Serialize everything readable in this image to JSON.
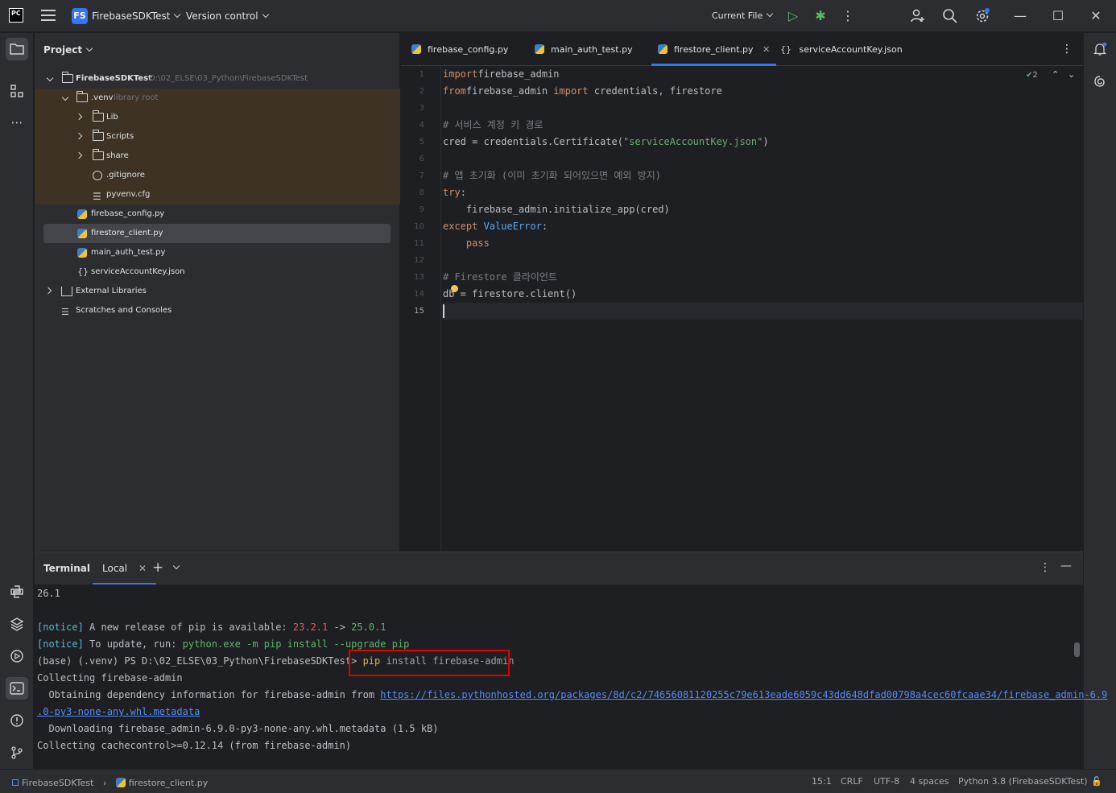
{
  "titlebar": {
    "app_logo": "PC",
    "project_badge": "FS",
    "project_name": "FirebaseSDKTest",
    "version_control": "Version control",
    "run_config": "Current File",
    "icons": [
      "menu-icon",
      "run-icon",
      "debug-icon",
      "more-icon",
      "add-user-icon",
      "search-icon",
      "settings-icon",
      "minimize-icon",
      "maximize-icon",
      "close-icon"
    ]
  },
  "project_panel": {
    "header": "Project",
    "root_name": "FirebaseSDKTest",
    "root_path": "D:\\02_ELSE\\03_Python\\FirebaseSDKTest",
    "venv_name": ".venv",
    "venv_note": "library root",
    "items": [
      {
        "label": "Lib"
      },
      {
        "label": "Scripts"
      },
      {
        "label": "share"
      },
      {
        "label": ".gitignore"
      },
      {
        "label": "pyvenv.cfg"
      },
      {
        "label": "firebase_config.py"
      },
      {
        "label": "firestore_client.py"
      },
      {
        "label": "main_auth_test.py"
      },
      {
        "label": "serviceAccountKey.json"
      },
      {
        "label": "External Libraries"
      },
      {
        "label": "Scratches and Consoles"
      }
    ]
  },
  "editor": {
    "tabs": [
      {
        "label": "firebase_config.py"
      },
      {
        "label": "main_auth_test.py"
      },
      {
        "label": "firestore_client.py"
      },
      {
        "label": "serviceAccountKey.json"
      }
    ],
    "inspection_count": "2",
    "lines": [
      {
        "n": "1",
        "parts": [
          [
            "kw",
            "import"
          ],
          [
            "",
            "firebase_admin"
          ]
        ]
      },
      {
        "n": "2",
        "parts": [
          [
            "kw",
            "from"
          ],
          [
            "",
            "firebase_admin "
          ],
          [
            "kw",
            "import"
          ],
          [
            "",
            " credentials, firestore"
          ]
        ]
      },
      {
        "n": "3",
        "parts": []
      },
      {
        "n": "4",
        "parts": [
          [
            "cmt",
            "# 서비스 계정 키 경로"
          ]
        ]
      },
      {
        "n": "5",
        "parts": [
          [
            "",
            "cred = credentials.Certificate("
          ],
          [
            "str",
            "\"serviceAccountKey.json\""
          ],
          [
            "",
            ")"
          ]
        ]
      },
      {
        "n": "6",
        "parts": []
      },
      {
        "n": "7",
        "parts": [
          [
            "cmt",
            "# 앱 초기화 (이미 초기화 되어있으면 예외 방지)"
          ]
        ]
      },
      {
        "n": "8",
        "parts": [
          [
            "kw",
            "try"
          ],
          [
            "",
            ":"
          ]
        ]
      },
      {
        "n": "9",
        "parts": [
          [
            "",
            "    firebase_admin.initialize_app(cred)"
          ]
        ]
      },
      {
        "n": "10",
        "parts": [
          [
            "kw",
            "except"
          ],
          [
            "",
            " "
          ],
          [
            "cls",
            "ValueError"
          ],
          [
            "",
            ":"
          ]
        ]
      },
      {
        "n": "11",
        "parts": [
          [
            "",
            "    "
          ],
          [
            "kw",
            "pass"
          ]
        ]
      },
      {
        "n": "12",
        "parts": []
      },
      {
        "n": "13",
        "parts": [
          [
            "cmt",
            "# Firestore 클라이언트"
          ]
        ]
      },
      {
        "n": "14",
        "parts": [
          [
            "",
            "db = firestore.client()"
          ]
        ]
      },
      {
        "n": "15",
        "parts": []
      }
    ]
  },
  "terminal": {
    "title": "Terminal",
    "tab": "Local",
    "lines": [
      [
        [
          "",
          "26.1"
        ]
      ],
      [],
      [
        [
          "t-cyan",
          "[notice]"
        ],
        [
          "",
          " A new release of pip is available: "
        ],
        [
          "t-red",
          "23.2.1"
        ],
        [
          "",
          " -> "
        ],
        [
          "t-green",
          "25.0.1"
        ]
      ],
      [
        [
          "t-cyan",
          "[notice]"
        ],
        [
          "",
          " To update, run: "
        ],
        [
          "t-green",
          "python.exe -m pip install --upgrade pip"
        ]
      ],
      [
        [
          "",
          "(base) (.venv) PS D:\\02_ELSE\\03_Python\\FirebaseSDKTest> "
        ],
        [
          "t-yellow",
          "pip"
        ],
        [
          "t-gray",
          " install firebase-admin"
        ]
      ],
      [
        [
          "",
          "Collecting firebase-admin"
        ]
      ],
      [
        [
          "",
          "  Obtaining dependency information for firebase-admin from "
        ],
        [
          "t-link",
          "https://files.pythonhosted.org/packages/8d/c2/74656081120255c79e613eade6059c43dd648dfad00798a4cec60fcaae34/firebase_admin-6.9"
        ]
      ],
      [
        [
          "t-link",
          ".0-py3-none-any.whl.metadata"
        ]
      ],
      [
        [
          "",
          "  Downloading firebase_admin-6.9.0-py3-none-any.whl.metadata (1.5 kB)"
        ]
      ],
      [
        [
          "",
          "Collecting cachecontrol>=0.12.14 (from firebase-admin)"
        ]
      ]
    ]
  },
  "statusbar": {
    "project": "FirebaseSDKTest",
    "file": "firestore_client.py",
    "position": "15:1",
    "line_ending": "CRLF",
    "encoding": "UTF-8",
    "indent": "4 spaces",
    "interpreter": "Python 3.8 (FirebaseSDKTest)"
  }
}
